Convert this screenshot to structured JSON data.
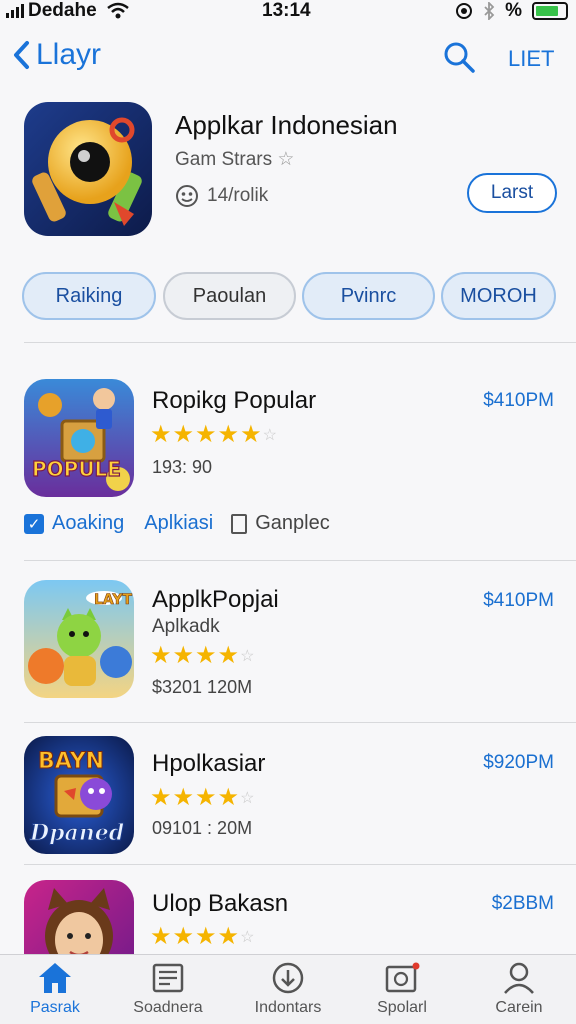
{
  "status_bar": {
    "carrier": "Dedahe",
    "time": "13:14",
    "battery_percent_label": "%"
  },
  "nav": {
    "back_label": "Llayr",
    "list_label": "LIET"
  },
  "hero": {
    "title": "Applkar Indonesian",
    "subtitle": "Gam Strars",
    "meta": "14/rolik",
    "install_label": "Larst"
  },
  "pills": [
    "Raiking",
    "Paoulan",
    "Pvinrc",
    "MOROH"
  ],
  "apps": [
    {
      "name": "Ropikg Popular",
      "rating": 4.5,
      "meta": "193: 90",
      "price": "$410PM"
    },
    {
      "name": "ApplkPopjai",
      "subtitle": "Aplkadk",
      "rating": 4,
      "meta": "$3201 120M",
      "price": "$410PM"
    },
    {
      "name": "Hpolkasiar",
      "rating": 4,
      "meta": "09101 : 20M",
      "price": "$920PM"
    },
    {
      "name": "Ulop Bakasn",
      "rating": 4,
      "price": "$2BBM"
    }
  ],
  "app_icons": [
    {
      "text": "POPULE"
    },
    {
      "text": "LAYT"
    },
    {
      "text": "BAYN",
      "text2": "Dpaned"
    }
  ],
  "tags": [
    "Aoaking",
    "Aplkiasi",
    "Ganplec"
  ],
  "tabbar": [
    {
      "label": "Pasrak",
      "icon": "home-icon",
      "active": true
    },
    {
      "label": "Soadnera",
      "icon": "newspaper-icon"
    },
    {
      "label": "Indontars",
      "icon": "download-icon"
    },
    {
      "label": "Spolarl",
      "icon": "media-icon"
    },
    {
      "label": "Carein",
      "icon": "person-icon"
    }
  ],
  "colors": {
    "accent": "#1a73d9",
    "star": "#f5b400",
    "battery": "#38c24a"
  }
}
